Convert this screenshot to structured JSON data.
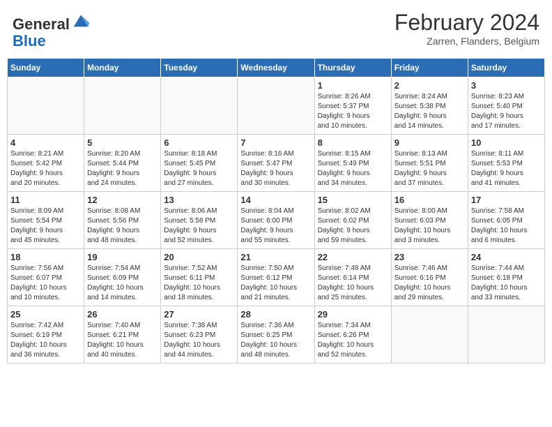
{
  "header": {
    "logo": {
      "line1": "General",
      "line2": "Blue"
    },
    "title": "February 2024",
    "location": "Zarren, Flanders, Belgium"
  },
  "weekdays": [
    "Sunday",
    "Monday",
    "Tuesday",
    "Wednesday",
    "Thursday",
    "Friday",
    "Saturday"
  ],
  "weeks": [
    [
      {
        "day": "",
        "info": ""
      },
      {
        "day": "",
        "info": ""
      },
      {
        "day": "",
        "info": ""
      },
      {
        "day": "",
        "info": ""
      },
      {
        "day": "1",
        "info": "Sunrise: 8:26 AM\nSunset: 5:37 PM\nDaylight: 9 hours\nand 10 minutes."
      },
      {
        "day": "2",
        "info": "Sunrise: 8:24 AM\nSunset: 5:38 PM\nDaylight: 9 hours\nand 14 minutes."
      },
      {
        "day": "3",
        "info": "Sunrise: 8:23 AM\nSunset: 5:40 PM\nDaylight: 9 hours\nand 17 minutes."
      }
    ],
    [
      {
        "day": "4",
        "info": "Sunrise: 8:21 AM\nSunset: 5:42 PM\nDaylight: 9 hours\nand 20 minutes."
      },
      {
        "day": "5",
        "info": "Sunrise: 8:20 AM\nSunset: 5:44 PM\nDaylight: 9 hours\nand 24 minutes."
      },
      {
        "day": "6",
        "info": "Sunrise: 8:18 AM\nSunset: 5:45 PM\nDaylight: 9 hours\nand 27 minutes."
      },
      {
        "day": "7",
        "info": "Sunrise: 8:16 AM\nSunset: 5:47 PM\nDaylight: 9 hours\nand 30 minutes."
      },
      {
        "day": "8",
        "info": "Sunrise: 8:15 AM\nSunset: 5:49 PM\nDaylight: 9 hours\nand 34 minutes."
      },
      {
        "day": "9",
        "info": "Sunrise: 8:13 AM\nSunset: 5:51 PM\nDaylight: 9 hours\nand 37 minutes."
      },
      {
        "day": "10",
        "info": "Sunrise: 8:11 AM\nSunset: 5:53 PM\nDaylight: 9 hours\nand 41 minutes."
      }
    ],
    [
      {
        "day": "11",
        "info": "Sunrise: 8:09 AM\nSunset: 5:54 PM\nDaylight: 9 hours\nand 45 minutes."
      },
      {
        "day": "12",
        "info": "Sunrise: 8:08 AM\nSunset: 5:56 PM\nDaylight: 9 hours\nand 48 minutes."
      },
      {
        "day": "13",
        "info": "Sunrise: 8:06 AM\nSunset: 5:58 PM\nDaylight: 9 hours\nand 52 minutes."
      },
      {
        "day": "14",
        "info": "Sunrise: 8:04 AM\nSunset: 6:00 PM\nDaylight: 9 hours\nand 55 minutes."
      },
      {
        "day": "15",
        "info": "Sunrise: 8:02 AM\nSunset: 6:02 PM\nDaylight: 9 hours\nand 59 minutes."
      },
      {
        "day": "16",
        "info": "Sunrise: 8:00 AM\nSunset: 6:03 PM\nDaylight: 10 hours\nand 3 minutes."
      },
      {
        "day": "17",
        "info": "Sunrise: 7:58 AM\nSunset: 6:05 PM\nDaylight: 10 hours\nand 6 minutes."
      }
    ],
    [
      {
        "day": "18",
        "info": "Sunrise: 7:56 AM\nSunset: 6:07 PM\nDaylight: 10 hours\nand 10 minutes."
      },
      {
        "day": "19",
        "info": "Sunrise: 7:54 AM\nSunset: 6:09 PM\nDaylight: 10 hours\nand 14 minutes."
      },
      {
        "day": "20",
        "info": "Sunrise: 7:52 AM\nSunset: 6:11 PM\nDaylight: 10 hours\nand 18 minutes."
      },
      {
        "day": "21",
        "info": "Sunrise: 7:50 AM\nSunset: 6:12 PM\nDaylight: 10 hours\nand 21 minutes."
      },
      {
        "day": "22",
        "info": "Sunrise: 7:48 AM\nSunset: 6:14 PM\nDaylight: 10 hours\nand 25 minutes."
      },
      {
        "day": "23",
        "info": "Sunrise: 7:46 AM\nSunset: 6:16 PM\nDaylight: 10 hours\nand 29 minutes."
      },
      {
        "day": "24",
        "info": "Sunrise: 7:44 AM\nSunset: 6:18 PM\nDaylight: 10 hours\nand 33 minutes."
      }
    ],
    [
      {
        "day": "25",
        "info": "Sunrise: 7:42 AM\nSunset: 6:19 PM\nDaylight: 10 hours\nand 36 minutes."
      },
      {
        "day": "26",
        "info": "Sunrise: 7:40 AM\nSunset: 6:21 PM\nDaylight: 10 hours\nand 40 minutes."
      },
      {
        "day": "27",
        "info": "Sunrise: 7:38 AM\nSunset: 6:23 PM\nDaylight: 10 hours\nand 44 minutes."
      },
      {
        "day": "28",
        "info": "Sunrise: 7:36 AM\nSunset: 6:25 PM\nDaylight: 10 hours\nand 48 minutes."
      },
      {
        "day": "29",
        "info": "Sunrise: 7:34 AM\nSunset: 6:26 PM\nDaylight: 10 hours\nand 52 minutes."
      },
      {
        "day": "",
        "info": ""
      },
      {
        "day": "",
        "info": ""
      }
    ]
  ]
}
